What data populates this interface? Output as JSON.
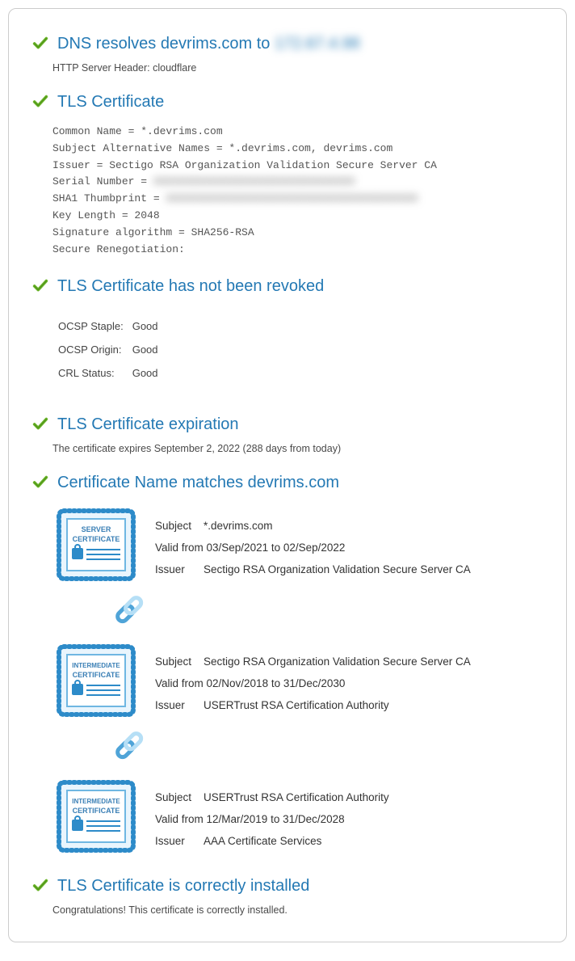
{
  "sections": {
    "dns": {
      "title_prefix": "DNS resolves devrims.com to ",
      "title_ip_masked": "172.67.4.98",
      "server_header": "HTTP Server Header: cloudflare"
    },
    "tls_cert": {
      "title": "TLS Certificate",
      "lines": {
        "cn": "Common Name = *.devrims.com",
        "san": "Subject Alternative Names = *.devrims.com, devrims.com",
        "issuer": "Issuer = Sectigo RSA Organization Validation Secure Server CA",
        "serial_label": "Serial Number = ",
        "serial_val_masked": "XXXXXXXXXXXXXXXXXXXXXXXXXXXXXXXX",
        "sha1_label": "SHA1 Thumbprint = ",
        "sha1_val_masked": "XXXXXXXXXXXXXXXXXXXXXXXXXXXXXXXXXXXXXXXX",
        "keylen": "Key Length = 2048",
        "sigalg": "Signature algorithm = SHA256-RSA",
        "reneg": "Secure Renegotiation:"
      }
    },
    "revocation": {
      "title": "TLS Certificate has not been revoked",
      "rows": {
        "ocsp_staple_label": "OCSP Staple:",
        "ocsp_staple_val": "Good",
        "ocsp_origin_label": "OCSP Origin:",
        "ocsp_origin_val": "Good",
        "crl_label": "CRL Status:",
        "crl_val": "Good"
      }
    },
    "expiration": {
      "title": "TLS Certificate expiration",
      "text": "The certificate expires September 2, 2022 (288 days from today)"
    },
    "name_match": {
      "title": "Certificate Name matches devrims.com"
    },
    "installed": {
      "title": "TLS Certificate is correctly installed",
      "text": "Congratulations! This certificate is correctly installed."
    }
  },
  "cert_chain": [
    {
      "badge_title_line1": "SERVER",
      "badge_title_line2": "CERTIFICATE",
      "subject": "*.devrims.com",
      "valid": "Valid from 03/Sep/2021 to 02/Sep/2022",
      "issuer": "Sectigo RSA Organization Validation Secure Server CA"
    },
    {
      "badge_title_line1": "INTERMEDIATE",
      "badge_title_line2": "CERTIFICATE",
      "subject": "Sectigo RSA Organization Validation Secure Server CA",
      "valid": "Valid from 02/Nov/2018 to 31/Dec/2030",
      "issuer": "USERTrust RSA Certification Authority"
    },
    {
      "badge_title_line1": "INTERMEDIATE",
      "badge_title_line2": "CERTIFICATE",
      "subject": "USERTrust RSA Certification Authority",
      "valid": "Valid from 12/Mar/2019 to 31/Dec/2028",
      "issuer": "AAA Certificate Services"
    }
  ],
  "labels": {
    "subject": "Subject",
    "issuer": "Issuer"
  }
}
